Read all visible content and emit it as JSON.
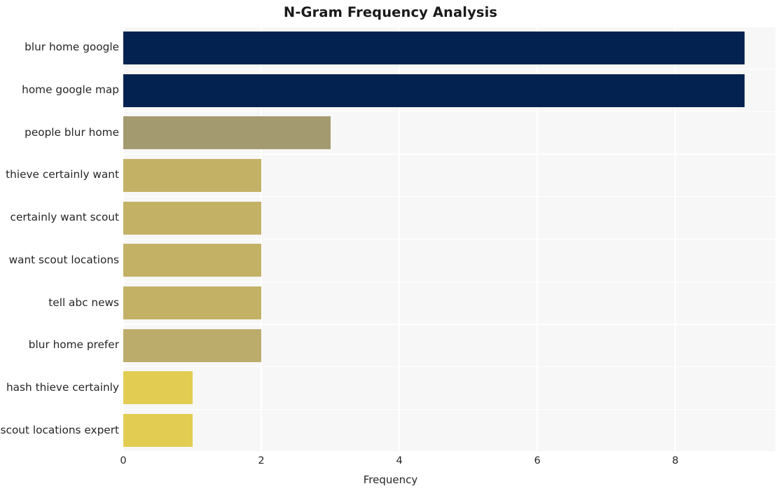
{
  "chart_data": {
    "type": "bar",
    "orientation": "horizontal",
    "title": "N-Gram Frequency Analysis",
    "xlabel": "Frequency",
    "ylabel": "",
    "categories": [
      "blur home google",
      "home google map",
      "people blur home",
      "thieve certainly want",
      "certainly want scout",
      "want scout locations",
      "tell abc news",
      "blur home prefer",
      "hash thieve certainly",
      "scout locations expert"
    ],
    "values": [
      9,
      9,
      3,
      2,
      2,
      2,
      2,
      2,
      1,
      1
    ],
    "bar_colors": [
      "#04224f",
      "#04224f",
      "#a49a70",
      "#c3b166",
      "#c3b166",
      "#c3b166",
      "#c3b166",
      "#bcac6b",
      "#e2cd52",
      "#e2cd52"
    ],
    "xlim": [
      0,
      9.45
    ],
    "xticks": [
      0,
      2,
      4,
      6,
      8
    ],
    "xtick_labels": [
      "0",
      "2",
      "4",
      "6",
      "8"
    ],
    "grid": true,
    "grid_color": "#ffffff",
    "plot_background": "#f7f7f7",
    "figure_background": "#ffffff",
    "legend": null
  }
}
